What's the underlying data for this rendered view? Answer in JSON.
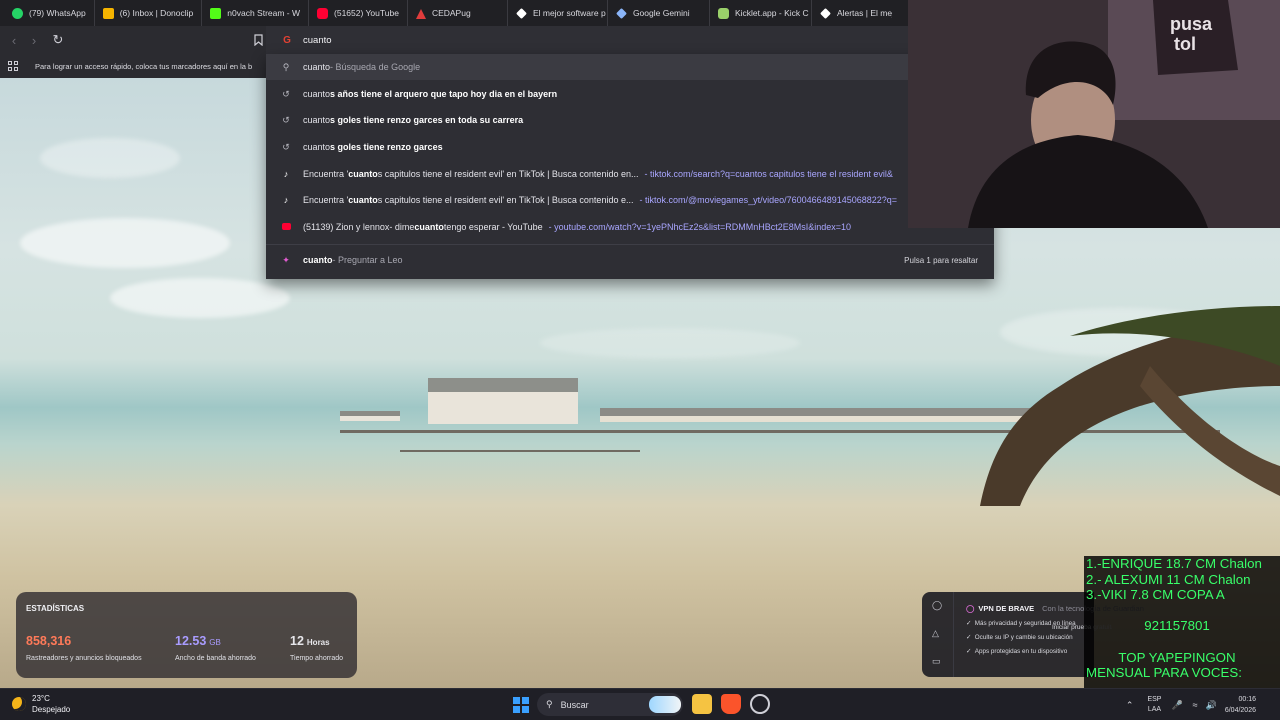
{
  "tabs": [
    {
      "label": "(79) WhatsApp",
      "icon": "whatsapp-icon",
      "color": "#25d366"
    },
    {
      "label": "(6) Inbox | Donoclip",
      "icon": "donoclip-icon",
      "color": "#f5b400"
    },
    {
      "label": "n0vach Stream - W",
      "icon": "kick-icon",
      "color": "#53fc18"
    },
    {
      "label": "(51652) YouTube",
      "icon": "youtube-icon",
      "color": "#ff0033"
    },
    {
      "label": "CEDAPug",
      "icon": "cedapug-icon",
      "color": "#e03c3c"
    },
    {
      "label": "El mejor software p",
      "icon": "diamond-icon",
      "color": "#ffffff"
    },
    {
      "label": "Google Gemini",
      "icon": "gemini-icon",
      "color": "#8ab4f8"
    },
    {
      "label": "Kicklet.app - Kick C",
      "icon": "kicklet-icon",
      "color": "#9ad06a"
    },
    {
      "label": "Alertas | El mejo",
      "icon": "diamond-icon",
      "color": "#ffffff"
    }
  ],
  "omnibox": {
    "value": "cuanto"
  },
  "bookmarks_bar": {
    "text": "Para lograr un acceso rápido, coloca tus marcadores aquí en la b"
  },
  "suggestions": [
    {
      "icon": "search-icon",
      "prefix": "cuanto",
      "bold": "",
      "rest": " - Búsqueda de Google",
      "url": ""
    },
    {
      "icon": "history-icon",
      "prefix": "cuanto",
      "bold": "s años tiene el arquero que tapo hoy dia en el bayern",
      "rest": "",
      "url": ""
    },
    {
      "icon": "history-icon",
      "prefix": "cuanto",
      "bold": "s goles tiene renzo garces en toda su carrera",
      "rest": "",
      "url": ""
    },
    {
      "icon": "history-icon",
      "prefix": "cuanto",
      "bold": "s goles tiene renzo garces",
      "rest": "",
      "url": ""
    },
    {
      "icon": "tiktok-icon",
      "text_a": "Encuentra '",
      "bold": "cuanto",
      "text_b": "s capitulos tiene el resident evil' en TikTok | Busca contenido en...",
      "url": " - tiktok.com/search?q=cuantos capitulos tiene el resident evil&"
    },
    {
      "icon": "tiktok-icon",
      "text_a": "Encuentra '",
      "bold": "cuanto",
      "text_b": "s capitulos tiene el resident evil' en TikTok | Busca contenido e...",
      "url": " - tiktok.com/@moviegames_yt/video/7600466489145068822?q="
    },
    {
      "icon": "youtube-icon",
      "text_a": "(51139) Zion y lennox- dime ",
      "bold": "cuanto",
      "text_b": " tengo esperar - YouTube",
      "url": " - youtube.com/watch?v=1yePNhcEz2s&list=RDMMnHBct2E8MsI&index=10"
    },
    {
      "icon": "leo-icon",
      "prefix": "cuanto",
      "bold": "",
      "rest": " - Preguntar a Leo",
      "hint": "Pulsa 1 para resaltar"
    }
  ],
  "stats": {
    "title": "ESTADÍSTICAS",
    "items": [
      {
        "value": "858,316",
        "unit": "",
        "label": "Rastreadores y anuncios bloqueados",
        "color": "#ff7a59"
      },
      {
        "value": "12.53",
        "unit": "GB",
        "label": "Ancho de banda ahorrado",
        "color": "#a99cff"
      },
      {
        "value": "12",
        "unit": "Horas",
        "label": "Tiempo ahorrado",
        "color": "#ffffff"
      }
    ]
  },
  "vpn": {
    "title": "VPN DE BRAVE",
    "subtitle": "Con la tecnología de Guardian",
    "bullets": [
      "Más privacidad y seguridad en línea",
      "Oculte su IP y cambie su ubicación",
      "Apps protegidas en tu dispositivo"
    ],
    "cta": "Iniciar prueba gratuita"
  },
  "chat_overlay": {
    "lines": [
      "1.-ENRIQUE 18.7 CM Chalon",
      "2.- ALEXUMI 11 CM Chalon",
      "3.-VIKI 7.8 CM COPA A",
      "",
      "921157801",
      "",
      "TOP YAPEPINGON",
      "MENSUAL PARA VOCES:"
    ]
  },
  "taskbar": {
    "weather_temp": "23°C",
    "weather_desc": "Despejado",
    "search_label": "Buscar",
    "lang_top": "ESP",
    "lang_bottom": "LAA",
    "time": "00:16",
    "date": "6/04/2026"
  }
}
